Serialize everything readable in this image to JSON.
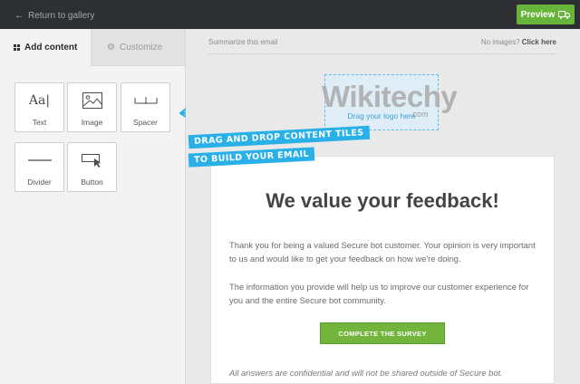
{
  "topbar": {
    "back_label": "Return to gallery",
    "back_icon": "arrow-left-icon",
    "preview_label": "Preview",
    "preview_icon": "truck-icon",
    "accent_color": "#68b33a"
  },
  "sidebar": {
    "tabs": [
      {
        "label": "Add content",
        "icon": "grid-icon",
        "active": true
      },
      {
        "label": "Customize",
        "icon": "gear-icon",
        "active": false
      }
    ],
    "tiles": [
      {
        "label": "Text",
        "icon": "text-icon"
      },
      {
        "label": "Image",
        "icon": "image-icon"
      },
      {
        "label": "Spacer",
        "icon": "spacer-icon"
      },
      {
        "label": "Divider",
        "icon": "divider-icon"
      },
      {
        "label": "Button",
        "icon": "button-icon"
      }
    ],
    "callout_line1": "DRAG AND DROP CONTENT TILES",
    "callout_line2": "TO BUILD YOUR EMAIL",
    "callout_color": "#2ab0e8"
  },
  "email": {
    "summary_label": "Summarize this email",
    "no_images_prefix": "No images?",
    "no_images_link": "Click here",
    "logo_placeholder": "Drag your logo here",
    "watermark_word": "Wikitechy",
    "watermark_sub": ".com",
    "title": "We value your feedback!",
    "paragraph1": "Thank you for being a valued Secure bot customer. Your opinion is very important to us and would like to get your feedback on how we're doing.",
    "paragraph2": "The information you provide will help us to improve our customer experience for you and the entire Secure bot community.",
    "button_label": "COMPLETE THE SURVEY",
    "footnote": "All answers are confidential and will not be shared outside of Secure bot."
  }
}
